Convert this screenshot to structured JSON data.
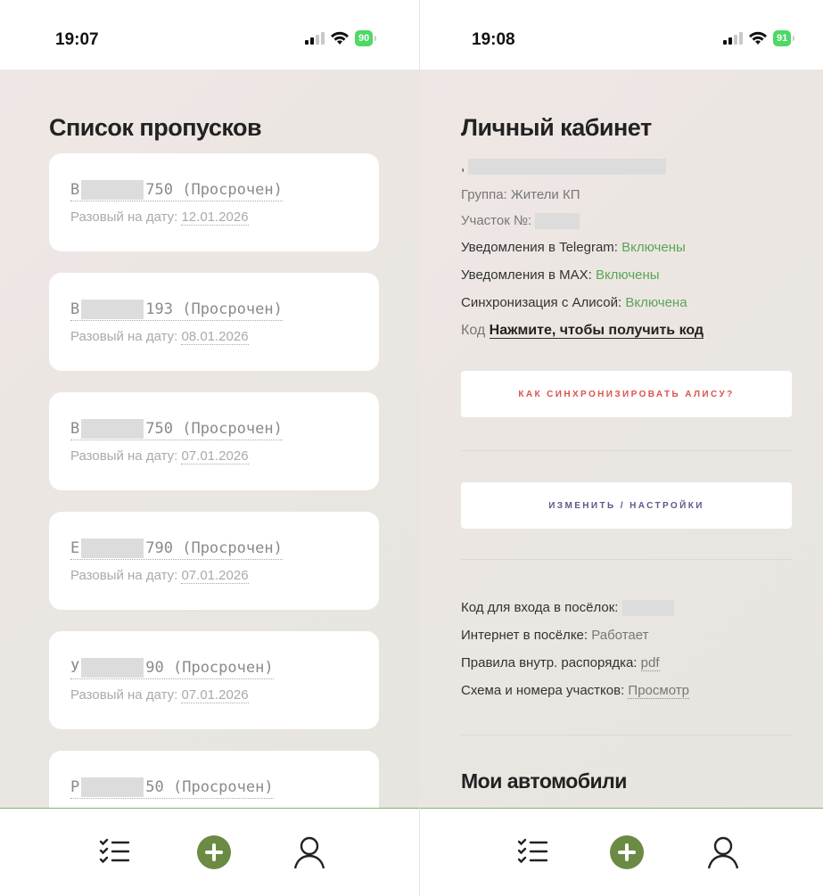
{
  "left": {
    "status": {
      "time": "19:07",
      "battery": "90"
    },
    "title": "Список пропусков",
    "passes": [
      {
        "plate_start": "В",
        "plate_end": "750",
        "status": "(Просрочен)",
        "date_label": "Разовый на дату:",
        "date": "12.01.2026"
      },
      {
        "plate_start": "В",
        "plate_end": "193",
        "status": "(Просрочен)",
        "date_label": "Разовый на дату:",
        "date": "08.01.2026"
      },
      {
        "plate_start": "В",
        "plate_end": "750",
        "status": "(Просрочен)",
        "date_label": "Разовый на дату:",
        "date": "07.01.2026"
      },
      {
        "plate_start": "Е",
        "plate_end": "790",
        "status": "(Просрочен)",
        "date_label": "Разовый на дату:",
        "date": "07.01.2026"
      },
      {
        "plate_start": "У",
        "plate_end": "90",
        "status": "(Просрочен)",
        "date_label": "Разовый на дату:",
        "date": "07.01.2026"
      },
      {
        "plate_start": "Р",
        "plate_end": "50",
        "status": "(Просрочен)",
        "date_label": "",
        "date": ""
      }
    ]
  },
  "right": {
    "status": {
      "time": "19:08",
      "battery": "91"
    },
    "title": "Личный кабинет",
    "name_prefix": ",",
    "group": {
      "label": "Группа:",
      "value": "Жители КП"
    },
    "plot": {
      "label": "Участок №:",
      "value": ""
    },
    "telegram": {
      "label": "Уведомления в Telegram:",
      "value": "Включены"
    },
    "max": {
      "label": "Уведомления в MAX:",
      "value": "Включены"
    },
    "alice": {
      "label": "Синхронизация с Алисой:",
      "value": "Включена"
    },
    "code": {
      "label": "Код",
      "value": "Нажмите, чтобы получить код"
    },
    "sync_button": "КАК СИНХРОНИЗИРОВАТЬ АЛИСУ?",
    "settings_button": "ИЗМЕНИТЬ / НАСТРОЙКИ",
    "entry_code": {
      "label": "Код для входа в посёлок:",
      "value": ""
    },
    "internet": {
      "label": "Интернет в посёлке:",
      "value": "Работает"
    },
    "rules": {
      "label": "Правила внутр. распорядка:",
      "value": "pdf"
    },
    "scheme": {
      "label": "Схема и номера участков:",
      "value": "Просмотр"
    },
    "cars_title": "Мои автомобили"
  },
  "tabbar": {
    "icons": [
      "checklist-icon",
      "add-circle-icon",
      "profile-icon"
    ]
  },
  "colors": {
    "accent_green": "#6b8b45",
    "enabled_green": "#5aa455",
    "sync_red": "#d9534f",
    "settings_purple": "#5a5a8c",
    "tabbar_border": "#86b06b"
  }
}
